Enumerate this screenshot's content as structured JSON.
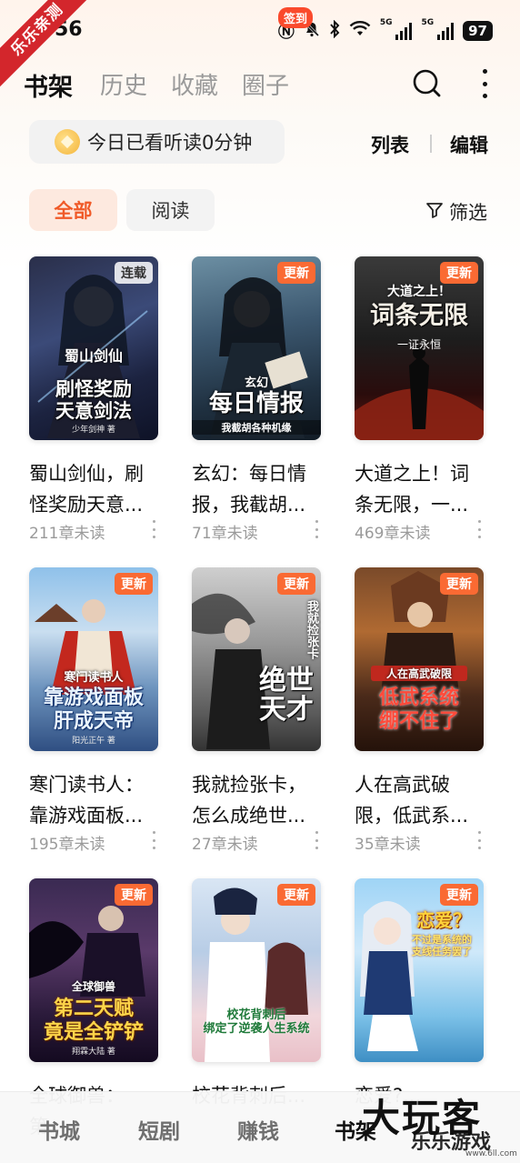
{
  "watermark": {
    "corner": "乐乐亲测",
    "big": "大玩客",
    "small": "乐乐游戏",
    "url": "www.6ll.com"
  },
  "status": {
    "time": "56",
    "battery": "97",
    "net1": "5G",
    "net2": "5G"
  },
  "header": {
    "tabs": [
      {
        "label": "书架"
      },
      {
        "label": "历史"
      },
      {
        "label": "收藏"
      },
      {
        "label": "圈子"
      }
    ]
  },
  "toolbar": {
    "today_text": "今日已看听读0分钟",
    "list_label": "列表",
    "edit_label": "编辑"
  },
  "filters": {
    "all": "全部",
    "read": "阅读",
    "filter_label": "筛选"
  },
  "books": [
    {
      "title": "蜀山剑仙，刷怪奖励天意...",
      "chapters": "211章未读",
      "badge": "连载",
      "cover_top": "蜀山剑仙",
      "cover_title": "刷怪奖励\n天意剑法",
      "cover_sub": "少年剑神 著"
    },
    {
      "title": "玄幻：每日情报，我截胡...",
      "chapters": "71章未读",
      "badge": "更新",
      "cover_top": "玄幻",
      "cover_title": "每日情报",
      "cover_sub": "我截胡各种机缘"
    },
    {
      "title": "大道之上！词条无限，一...",
      "chapters": "469章未读",
      "badge": "更新",
      "cover_top": "大道之上！",
      "cover_title": "词条无限",
      "cover_sub": "一证永恒"
    },
    {
      "title": "寒门读书人：靠游戏面板...",
      "chapters": "195章未读",
      "badge": "更新",
      "cover_top": "寒门读书人",
      "cover_title": "靠游戏面板\n肝成天帝",
      "cover_sub": "阳光正午 著"
    },
    {
      "title": "我就捡张卡，怎么成绝世...",
      "chapters": "27章未读",
      "badge": "更新",
      "cover_top": "我就捡张卡",
      "cover_title": "绝世\n天才",
      "cover_sub": ""
    },
    {
      "title": "人在高武破限，低武系...",
      "chapters": "35章未读",
      "badge": "更新",
      "cover_top": "人在高武破限",
      "cover_title": "低武系统\n绷不住了",
      "cover_sub": ""
    },
    {
      "title": "全球御兽：第...",
      "chapters": "",
      "badge": "更新",
      "cover_top": "全球御兽",
      "cover_title": "第二天赋\n竟是全铲铲",
      "cover_sub": "翔霖大陆 著"
    },
    {
      "title": "校花背刺后...",
      "chapters": "",
      "badge": "更新",
      "cover_top": "",
      "cover_title": "校花背刺后\n绑定了逆袭人生系统",
      "cover_sub": ""
    },
    {
      "title": "恋爱?...",
      "chapters": "",
      "badge": "更新",
      "cover_top": "恋爱？",
      "cover_title": "不过是系统的\n支线任务罢了",
      "cover_sub": ""
    }
  ],
  "nav": {
    "items": [
      {
        "label": "书城"
      },
      {
        "label": "短剧"
      },
      {
        "label": "赚钱"
      },
      {
        "label": "书架"
      }
    ],
    "sign_badge": "签到"
  },
  "colors": {
    "accent": "#f05a28",
    "badge_update": "#fa6a33"
  }
}
